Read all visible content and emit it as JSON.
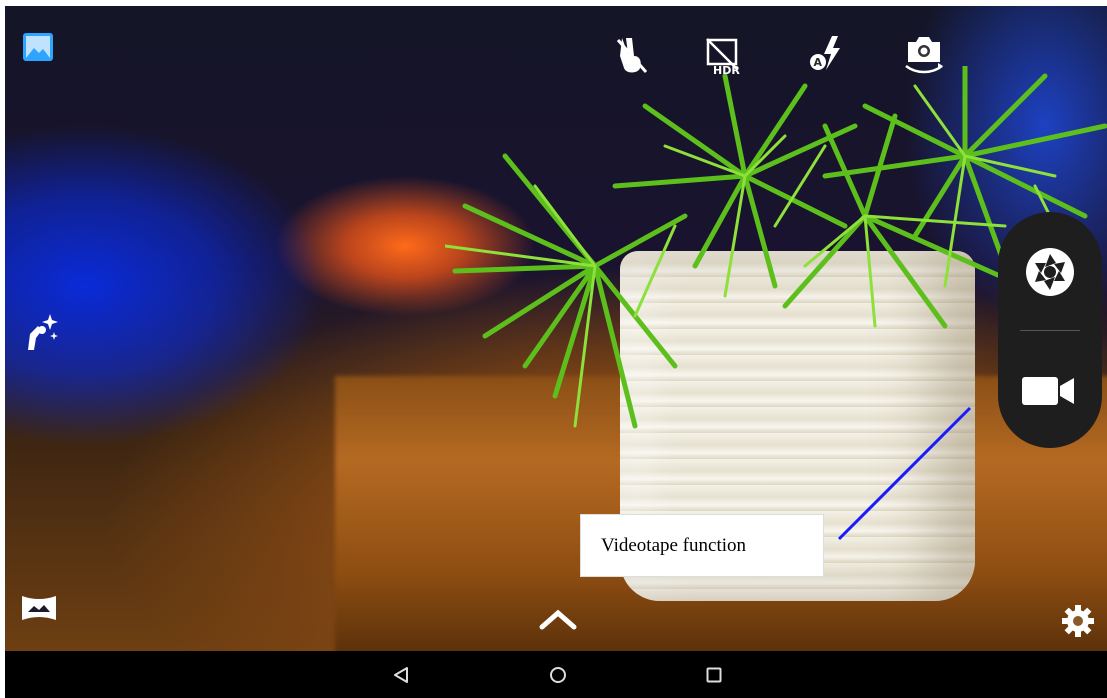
{
  "camera": {
    "top_icons": [
      "gesture-icon",
      "hdr-off-icon",
      "flash-auto-icon",
      "switch-camera-icon"
    ],
    "left_icons": [
      "gallery-icon",
      "beauty-icon",
      "panorama-icon"
    ],
    "hdr_label": "HDR",
    "flash_mode_label": "A",
    "capture_panel": {
      "photo": "shutter-icon",
      "video": "video-camera-icon"
    },
    "expand_icon": "chevron-up-icon",
    "settings_icon": "gear-icon"
  },
  "navbar": {
    "icons": [
      "back-icon",
      "home-icon",
      "recents-icon"
    ]
  },
  "annotation": {
    "label": "Videotape function",
    "line_color": "#1a1aff"
  }
}
